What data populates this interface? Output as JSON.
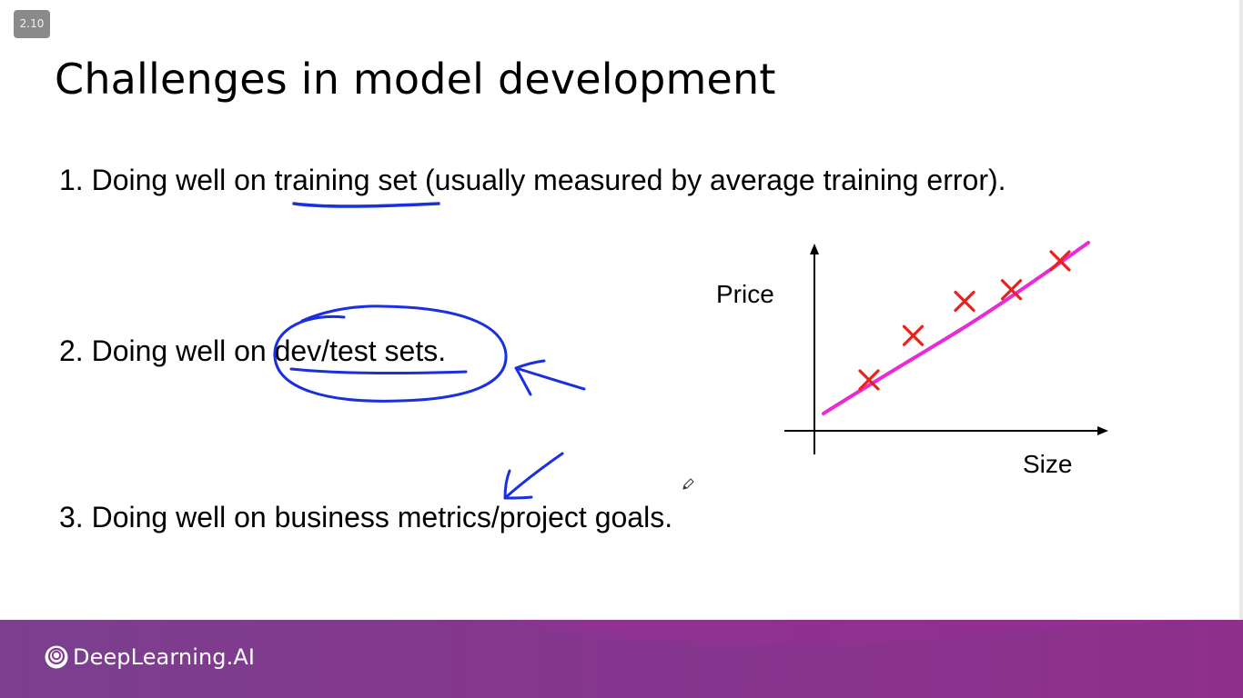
{
  "slide": {
    "badge": "2.10",
    "title": "Challenges in model development",
    "items": [
      "1. Doing well on training set (usually measured by average training error).",
      "2. Doing well on dev/test sets.",
      "3. Doing well on business metrics/project goals."
    ]
  },
  "chart_data": {
    "type": "scatter",
    "xlabel": "Size",
    "ylabel": "Price",
    "grid": false,
    "points_marker": "x",
    "series": [
      {
        "values": [
          [
            1,
            1
          ],
          [
            2,
            2
          ],
          [
            3,
            3
          ],
          [
            4,
            4
          ],
          [
            5,
            5
          ]
        ]
      }
    ],
    "fit_line": true,
    "colors": {
      "points": "#e8221c",
      "line": "#e82bd6",
      "axes": "#000000"
    }
  },
  "annotations": {
    "color": "#1a2fe0",
    "marks": [
      "underline-training-set",
      "circle-dev-test-sets",
      "arrow-to-dev-test",
      "arrow-to-business-metrics"
    ]
  },
  "footer": {
    "brand": "DeepLearning.AI",
    "brand_icon": "deeplearning-logo-icon",
    "colors": {
      "start": "#7b3f8e",
      "end": "#8e2f8c"
    }
  }
}
